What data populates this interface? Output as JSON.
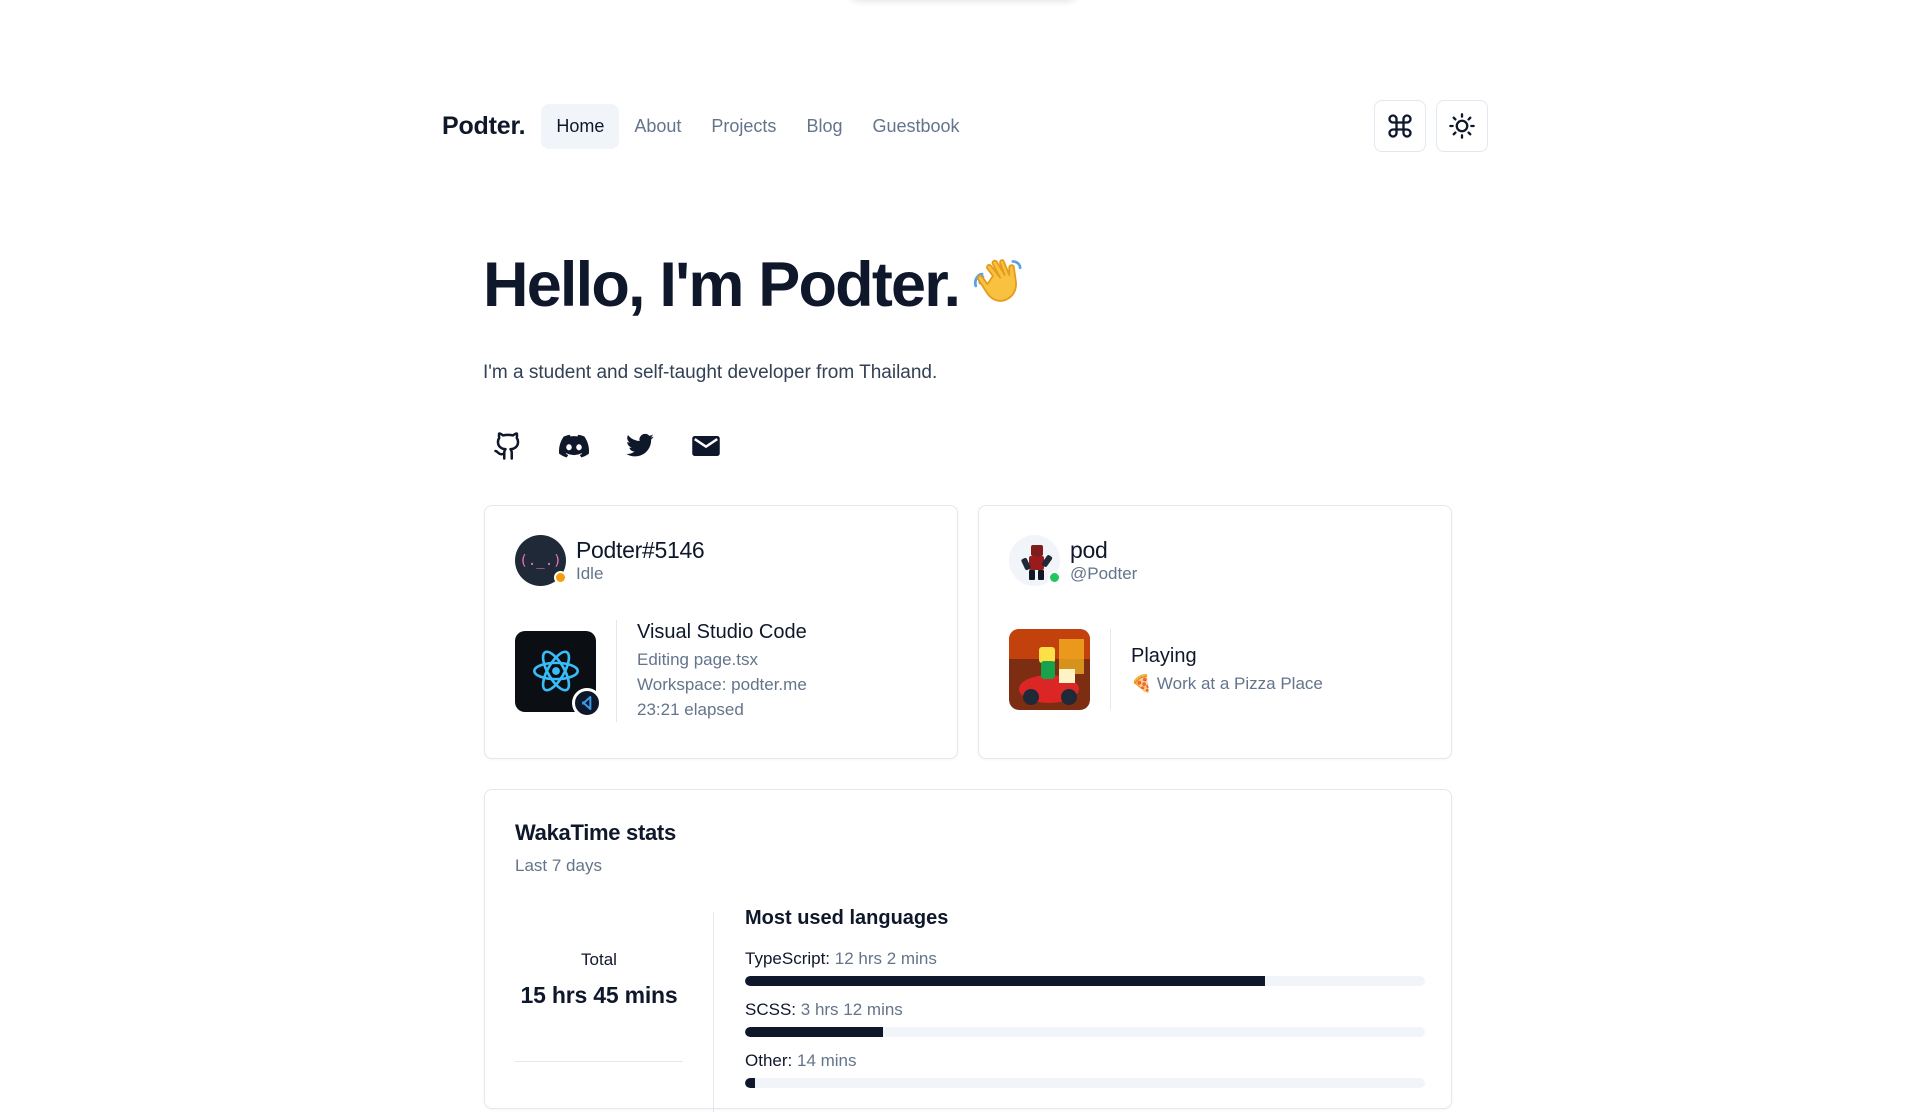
{
  "navbar": {
    "brand": "Podter.",
    "links": [
      {
        "label": "Home",
        "active": true
      },
      {
        "label": "About",
        "active": false
      },
      {
        "label": "Projects",
        "active": false
      },
      {
        "label": "Blog",
        "active": false
      },
      {
        "label": "Guestbook",
        "active": false
      }
    ],
    "command_icon": "command-icon",
    "theme_icon": "sun-icon"
  },
  "hero": {
    "title": "Hello, I'm Podter.",
    "wave_icon": "waving-hand-emoji",
    "subtitle": "I'm a student and self-taught developer from Thailand.",
    "socials": [
      "github-icon",
      "discord-icon",
      "twitter-icon",
      "mail-icon"
    ]
  },
  "discord_card": {
    "avatar_text": "(._.)",
    "name": "Podter#5146",
    "status": "Idle",
    "status_color": "#f59e0b",
    "activity": {
      "title": "Visual Studio Code",
      "lines": [
        "Editing page.tsx",
        "Workspace: podter.me",
        "23:21 elapsed"
      ]
    }
  },
  "roblox_card": {
    "name": "pod",
    "handle": "@Podter",
    "status_color": "#22c55e",
    "activity": {
      "title": "Playing",
      "game": "🍕 Work at a Pizza Place"
    }
  },
  "wakatime": {
    "title": "WakaTime stats",
    "subtitle": "Last 7 days",
    "total_label": "Total",
    "total_value": "15 hrs 45 mins",
    "languages_title": "Most used languages",
    "languages": [
      {
        "name": "TypeScript:",
        "time": "12 hrs 2 mins",
        "percent": 76.4
      },
      {
        "name": "SCSS:",
        "time": "3 hrs 12 mins",
        "percent": 20.3
      },
      {
        "name": "Other:",
        "time": "14 mins",
        "percent": 1.5
      }
    ]
  }
}
